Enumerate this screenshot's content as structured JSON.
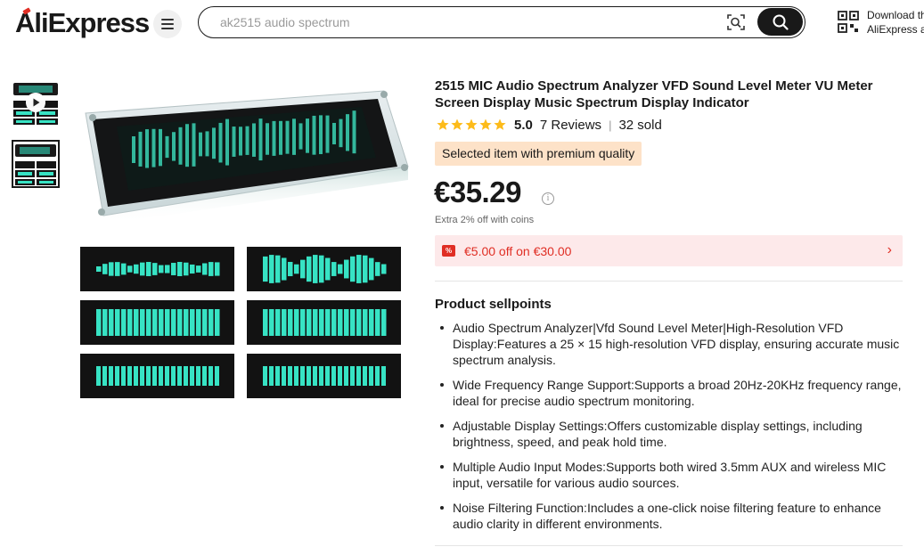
{
  "header": {
    "logo_text": "AliExpress",
    "search_placeholder": "ak2515 audio spectrum",
    "download_line1": "Download the",
    "download_line2": "AliExpress app"
  },
  "product": {
    "title": "2515 MIC Audio Spectrum Analyzer VFD Sound Level Meter VU Meter Screen Display Music Spectrum Display Indicator",
    "rating_score": "5.0",
    "reviews": "7 Reviews",
    "rating_separator": "|",
    "sold": "32 sold",
    "premium_badge": "Selected item with premium quality",
    "price": "€35.29",
    "info_icon_glyph": "i",
    "coins_text": "Extra 2% off with coins",
    "coupon_text": "€5.00 off on €30.00",
    "coupon_icon_glyph": "%",
    "coupon_arrow_glyph": "›"
  },
  "sellpoints": {
    "title": "Product sellpoints",
    "items": [
      "Audio Spectrum Analyzer|Vfd Sound Level Meter|High-Resolution VFD Display:Features a 25 × 15 high-resolution VFD display, ensuring accurate music spectrum analysis.",
      "Wide Frequency Range Support:Supports a broad 20Hz-20KHz frequency range, ideal for precise audio spectrum monitoring.",
      "Adjustable Display Settings:Offers customizable display settings, including brightness, speed, and peak hold time.",
      "Multiple Audio Input Modes:Supports both wired 3.5mm AUX and wireless MIC input, versatile for various audio sources.",
      "Noise Filtering Function:Includes a one-click noise filtering feature to enhance audio clarity in different environments."
    ]
  },
  "icons": {
    "menu": "hamburger-icon",
    "camera": "image-search-icon",
    "search": "search-icon",
    "qr": "qr-code-icon",
    "play": "play-icon",
    "star": "star-icon",
    "info": "info-icon",
    "coupon": "coupon-icon",
    "arrow": "chevron-right-icon"
  },
  "colors": {
    "accent_red": "#e02e24",
    "star_yellow": "#fdbb1a",
    "premium_bg": "#fde2c8",
    "coupon_bg": "#fde9ea",
    "vfd_green": "#37e3c4"
  }
}
